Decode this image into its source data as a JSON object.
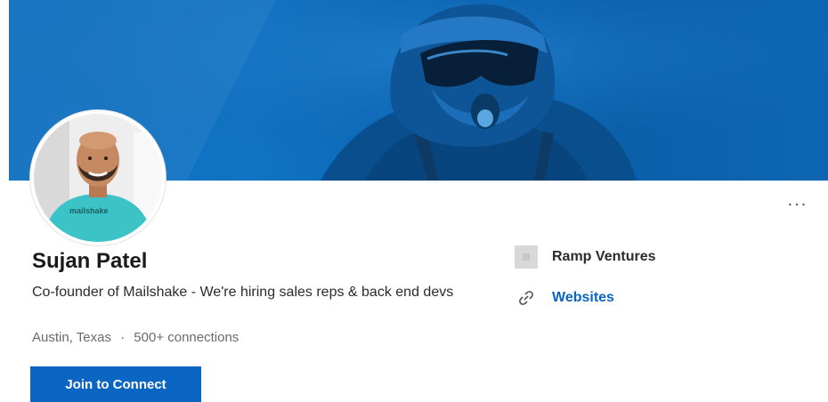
{
  "profile": {
    "name": "Sujan Patel",
    "headline": "Co-founder of Mailshake - We're hiring sales reps & back end devs",
    "location": "Austin, Texas",
    "separator": "·",
    "connections": "500+ connections",
    "avatar_shirt_text": "mailshake"
  },
  "actions": {
    "connect_label": "Join to Connect",
    "more_label": "..."
  },
  "sidebar": {
    "company_name": "Ramp Ventures",
    "websites_label": "Websites"
  },
  "colors": {
    "brand_blue": "#0a66c2",
    "banner_blue": "#0e6fbf"
  }
}
